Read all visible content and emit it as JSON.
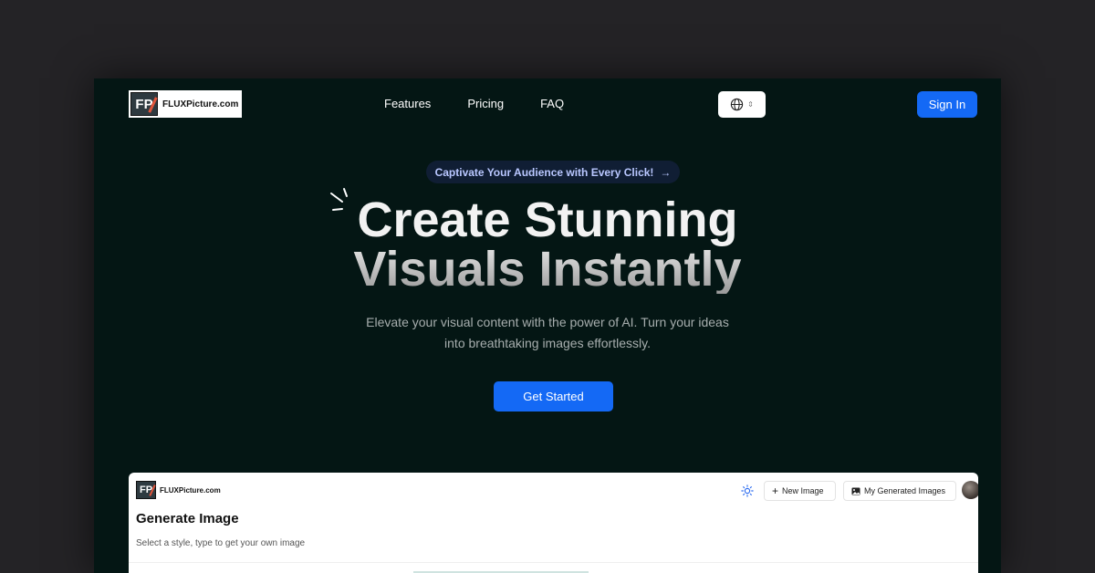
{
  "brand": {
    "name": "FLUXPicture.com",
    "mark": "FP"
  },
  "nav": {
    "items": [
      "Features",
      "Pricing",
      "FAQ"
    ]
  },
  "header": {
    "language_icon": "globe-icon",
    "signin_label": "Sign In"
  },
  "hero": {
    "pill": "Captivate Your Audience with Every Click!",
    "pill_arrow": "→",
    "title_line1": "Create Stunning",
    "title_line2": "Visuals Instantly",
    "subtitle_line1": "Elevate your visual content with the power of AI. Turn your ideas",
    "subtitle_line2": "into breathtaking images effortlessly.",
    "cta_label": "Get Started"
  },
  "preview": {
    "brand": "FLUXPicture.com",
    "new_image_label": "New Image",
    "my_images_label": "My Generated Images",
    "title": "Generate Image",
    "subtitle": "Select a style, type to get your own image"
  },
  "colors": {
    "accent": "#1469f5",
    "page_bg": "#041614",
    "outer_bg": "#242326"
  }
}
